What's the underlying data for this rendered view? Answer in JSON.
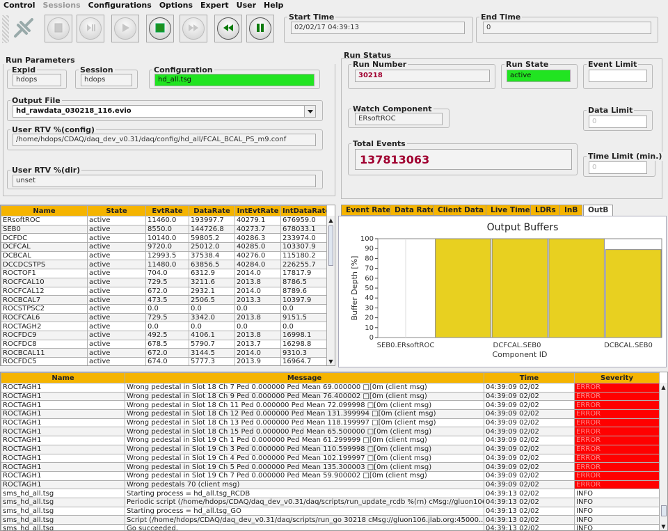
{
  "menu": [
    "Control",
    "Sessions",
    "Configurations",
    "Options",
    "Expert",
    "User",
    "Help"
  ],
  "times": {
    "start_label": "Start Time",
    "start_value": "02/02/17 04:39:13",
    "end_label": "End Time",
    "end_value": "0"
  },
  "run_params": {
    "title": "Run Parameters",
    "expid_label": "Expid",
    "expid": "hdops",
    "session_label": "Session",
    "session": "hdops",
    "config_label": "Configuration",
    "config": "hd_all.tsg",
    "output_label": "Output File",
    "output": "hd_rawdata_030218_116.evio",
    "rtv_config_label": "User RTV  %(config)",
    "rtv_config": "/home/hdops/CDAQ/daq_dev_v0.31/daq/config/hd_all/FCAL_BCAL_PS_m9.conf",
    "rtv_dir_label": "User RTV  %(dir)",
    "rtv_dir": "unset"
  },
  "run_status": {
    "title": "Run Status",
    "run_number_label": "Run Number",
    "run_number": "30218",
    "run_state_label": "Run State",
    "run_state": "active",
    "event_limit_label": "Event Limit",
    "event_limit": "",
    "watch_label": "Watch Component",
    "watch": "ERsoftROC",
    "data_limit_label": "Data Limit",
    "data_limit": "0",
    "total_label": "Total Events",
    "total": "137813063",
    "time_limit_label": "Time Limit (min.)",
    "time_limit": "0"
  },
  "comp_table": {
    "headers": [
      "Name",
      "State",
      "EvtRate",
      "DataRate",
      "IntEvtRate",
      "IntDataRate"
    ],
    "rows": [
      [
        "ERsoftROC",
        "active",
        "11460.0",
        "193997.7",
        "40279.1",
        "676959.0"
      ],
      [
        "SEB0",
        "active",
        "8550.0",
        "144726.8",
        "40273.7",
        "678033.1"
      ],
      [
        "DCFDC",
        "active",
        "10140.0",
        "59805.2",
        "40286.3",
        "233974.0"
      ],
      [
        "DCFCAL",
        "active",
        "9720.0",
        "25012.0",
        "40285.0",
        "103307.9"
      ],
      [
        "DCBCAL",
        "active",
        "12993.5",
        "37538.4",
        "40276.0",
        "115180.2"
      ],
      [
        "DCCDCSTPS",
        "active",
        "11480.0",
        "63856.5",
        "40284.0",
        "226255.7"
      ],
      [
        "ROCTOF1",
        "active",
        "704.0",
        "6312.9",
        "2014.0",
        "17817.9"
      ],
      [
        "ROCFCAL10",
        "active",
        "729.5",
        "3211.6",
        "2013.8",
        "8786.5"
      ],
      [
        "ROCFCAL12",
        "active",
        "672.0",
        "2932.1",
        "2014.0",
        "8789.6"
      ],
      [
        "ROCBCAL7",
        "active",
        "473.5",
        "2506.5",
        "2013.3",
        "10397.9"
      ],
      [
        "ROCSTPSC2",
        "active",
        "0.0",
        "0.0",
        "0.0",
        "0.0"
      ],
      [
        "ROCFCAL6",
        "active",
        "729.5",
        "3342.0",
        "2013.8",
        "9151.5"
      ],
      [
        "ROCTAGH2",
        "active",
        "0.0",
        "0.0",
        "0.0",
        "0.0"
      ],
      [
        "ROCFDC9",
        "active",
        "492.5",
        "4106.1",
        "2013.8",
        "16998.1"
      ],
      [
        "ROCFDC8",
        "active",
        "678.5",
        "5790.7",
        "2013.7",
        "16298.8"
      ],
      [
        "ROCBCAL11",
        "active",
        "672.0",
        "3144.5",
        "2014.0",
        "9310.3"
      ],
      [
        "ROCFDC5",
        "active",
        "674.0",
        "5777.3",
        "2013.9",
        "16964.7"
      ]
    ]
  },
  "tabs": [
    "Event Rate",
    "Data Rate",
    "Client Data",
    "Live Time",
    "LDRs",
    "InB",
    "OutB"
  ],
  "chart_data": {
    "type": "bar",
    "title": "Output Buffers",
    "xlabel": "Component ID",
    "ylabel": "Buffer Depth [%]",
    "categories": [
      "SEB0.ERsoftROC",
      "DCFCAL.SEB0",
      "",
      "DCBCAL.SEB0"
    ],
    "x_tick_labels": [
      "SEB0.ERsoftROC",
      "DCFCAL.SEB0",
      "DCBCAL.SEB0"
    ],
    "values": [
      0,
      100,
      100,
      100,
      89
    ],
    "ylim": [
      0,
      100
    ],
    "yticks": [
      "0",
      "10",
      "20",
      "30",
      "40",
      "50",
      "60",
      "70",
      "80",
      "90",
      "100"
    ],
    "color": "#e8d020"
  },
  "msg_table": {
    "headers": [
      "Name",
      "Message",
      "Time",
      "Severity"
    ],
    "rows": [
      [
        "ROCTAGH1",
        "Wrong pedestal in Slot 18  Ch 7   Ped 0.000000   Ped Mean  69.000000 □[0m (client msg)",
        "04:39:09 02/02",
        "ERROR"
      ],
      [
        "ROCTAGH1",
        "Wrong pedestal in Slot 18  Ch 9   Ped 0.000000   Ped Mean  76.400002 □[0m (client msg)",
        "04:39:09 02/02",
        "ERROR"
      ],
      [
        "ROCTAGH1",
        "Wrong pedestal in Slot 18  Ch 11   Ped 0.000000   Ped Mean  72.099998 □[0m (client msg)",
        "04:39:09 02/02",
        "ERROR"
      ],
      [
        "ROCTAGH1",
        "Wrong pedestal in Slot 18  Ch 12   Ped 0.000000   Ped Mean  131.399994 □[0m (client msg)",
        "04:39:09 02/02",
        "ERROR"
      ],
      [
        "ROCTAGH1",
        "Wrong pedestal in Slot 18  Ch 13   Ped 0.000000   Ped Mean  118.199997 □[0m (client msg)",
        "04:39:09 02/02",
        "ERROR"
      ],
      [
        "ROCTAGH1",
        "Wrong pedestal in Slot 18  Ch 15   Ped 0.000000   Ped Mean  65.500000 □[0m (client msg)",
        "04:39:09 02/02",
        "ERROR"
      ],
      [
        "ROCTAGH1",
        "Wrong pedestal in Slot 19  Ch 1   Ped 0.000000   Ped Mean  61.299999 □[0m (client msg)",
        "04:39:09 02/02",
        "ERROR"
      ],
      [
        "ROCTAGH1",
        "Wrong pedestal in Slot 19  Ch 3   Ped 0.000000   Ped Mean  110.599998 □[0m (client msg)",
        "04:39:09 02/02",
        "ERROR"
      ],
      [
        "ROCTAGH1",
        "Wrong pedestal in Slot 19  Ch 4   Ped 0.000000   Ped Mean  102.199997 □[0m (client msg)",
        "04:39:09 02/02",
        "ERROR"
      ],
      [
        "ROCTAGH1",
        "Wrong pedestal in Slot 19  Ch 5   Ped 0.000000   Ped Mean  135.300003 □[0m (client msg)",
        "04:39:09 02/02",
        "ERROR"
      ],
      [
        "ROCTAGH1",
        "Wrong pedestal in Slot 19  Ch 7   Ped 0.000000   Ped Mean  59.900002 □[0m (client msg)",
        "04:39:09 02/02",
        "ERROR"
      ],
      [
        "ROCTAGH1",
        "Wrong pedestals  70  (client msg)",
        "04:39:09 02/02",
        "ERROR"
      ],
      [
        "sms_hd_all.tsg",
        "Starting process = hd_all.tsg_RCDB",
        "04:39:13 02/02",
        "INFO"
      ],
      [
        "sms_hd_all.tsg",
        "Periodic script (/home/hdops/CDAQ/daq_dev_v0.31/daq/scripts/run_update_rcdb  %(rn)  cMsg://gluon106...",
        "04:39:13 02/02",
        "INFO"
      ],
      [
        "sms_hd_all.tsg",
        "Starting process = hd_all.tsg_GO",
        "04:39:13 02/02",
        "INFO"
      ],
      [
        "sms_hd_all.tsg",
        "Script (/home/hdops/CDAQ/daq_dev_v0.31/daq/scripts/run_go  30218  cMsg://gluon106.jlab.org:45000...",
        "04:39:13 02/02",
        "INFO"
      ],
      [
        "sms_hd_all.tsg",
        "Go succeeded.",
        "04:39:13 02/02",
        "INFO"
      ]
    ]
  },
  "colors": {
    "header_orange": "#f5b400",
    "error_red": "#ff0000",
    "active_green": "#21e421",
    "bar_yellow": "#e8d020"
  }
}
